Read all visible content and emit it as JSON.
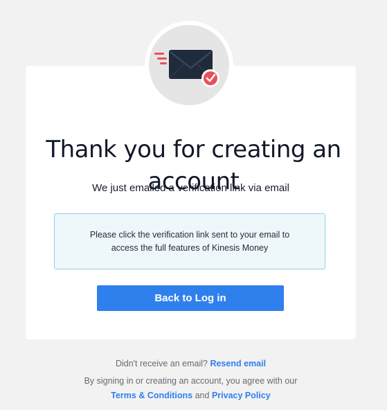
{
  "heading": {
    "title": "Thank you for creating an account",
    "subtitle": "We just emailed a verification link via email"
  },
  "info_box": {
    "text": "Please click the verification link sent to your email to access the full features of Kinesis Money"
  },
  "button": {
    "label": "Back to Log in"
  },
  "footer": {
    "resend_prompt": "Didn't receive an email?",
    "resend_link": "Resend email",
    "agreement_text": "By signing in or creating an account, you agree with our",
    "terms_link": "Terms & Conditions",
    "conjunction": "and",
    "privacy_link": "Privacy Policy"
  },
  "icons": {
    "main": "envelope-icon",
    "badge": "check-badge-icon",
    "motion": "speed-lines-icon"
  },
  "colors": {
    "accent": "#2f80ed",
    "check_badge": "#e8505b",
    "envelope": "#1f2a3a",
    "info_border": "#8fd0e3",
    "info_background": "#eef7fa"
  }
}
